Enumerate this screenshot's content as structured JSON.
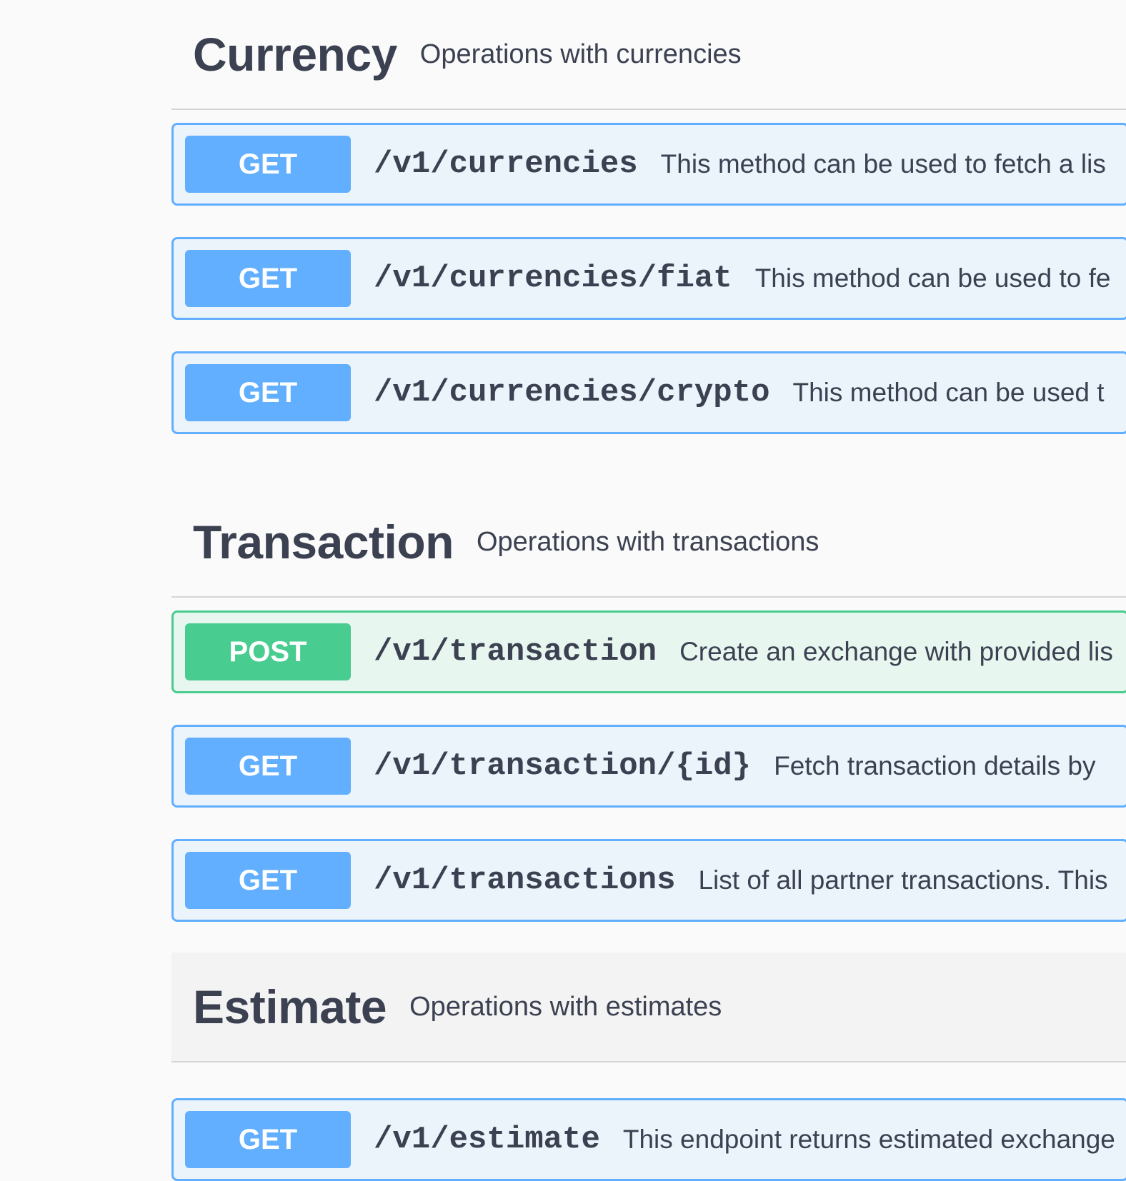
{
  "sections": [
    {
      "title": "Currency",
      "description": "Operations with currencies",
      "operations": [
        {
          "method": "GET",
          "path": "/v1/currencies",
          "summary": "This method can be used to fetch a lis"
        },
        {
          "method": "GET",
          "path": "/v1/currencies/fiat",
          "summary": "This method can be used to fe"
        },
        {
          "method": "GET",
          "path": "/v1/currencies/crypto",
          "summary": "This method can be used t"
        }
      ]
    },
    {
      "title": "Transaction",
      "description": "Operations with transactions",
      "operations": [
        {
          "method": "POST",
          "path": "/v1/transaction",
          "summary": "Create an exchange with provided lis"
        },
        {
          "method": "GET",
          "path": "/v1/transaction/{id}",
          "summary": "Fetch transaction details by"
        },
        {
          "method": "GET",
          "path": "/v1/transactions",
          "summary": "List of all partner transactions. This"
        }
      ]
    },
    {
      "title": "Estimate",
      "description": "Operations with estimates",
      "operations": [
        {
          "method": "GET",
          "path": "/v1/estimate",
          "summary": "This endpoint returns estimated exchange"
        }
      ]
    }
  ],
  "colors": {
    "get": "#61affe",
    "post": "#49cc90",
    "text": "#3b4151"
  }
}
